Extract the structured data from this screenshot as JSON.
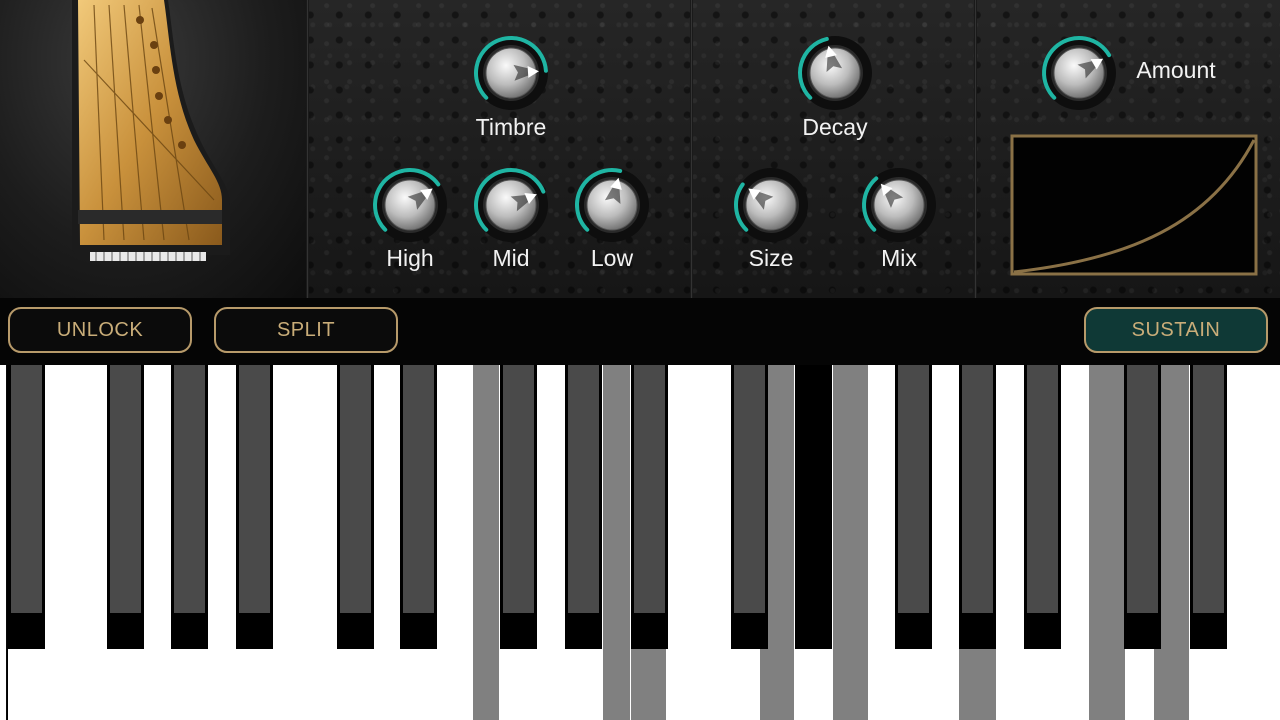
{
  "knobs": {
    "timbre": {
      "label": "Timbre",
      "value": 0.82
    },
    "high": {
      "label": "High",
      "value": 0.7
    },
    "mid": {
      "label": "Mid",
      "value": 0.75
    },
    "low": {
      "label": "Low",
      "value": 0.55
    },
    "decay": {
      "label": "Decay",
      "value": 0.45
    },
    "size": {
      "label": "Size",
      "value": 0.3
    },
    "mix": {
      "label": "Mix",
      "value": 0.35
    },
    "amount": {
      "label": "Amount",
      "value": 0.72
    }
  },
  "buttons": {
    "unlock": "UNLOCK",
    "split": "SPLIT",
    "sustain": "SUSTAIN"
  },
  "keyboard": {
    "white_key_count": 23,
    "pressed_white_keys": [
      14,
      18,
      19,
      23,
      25,
      29,
      33,
      35
    ]
  },
  "colors": {
    "accent": "#1fb5a3",
    "button_border": "#b79a6a",
    "button_text": "#c9ad79",
    "sustain_bg": "#0f3936",
    "pressed_key": "#808080",
    "black_key": "#4a4a4a"
  },
  "icons": {
    "piano": "grand-piano-image",
    "curve": "velocity-curve"
  }
}
